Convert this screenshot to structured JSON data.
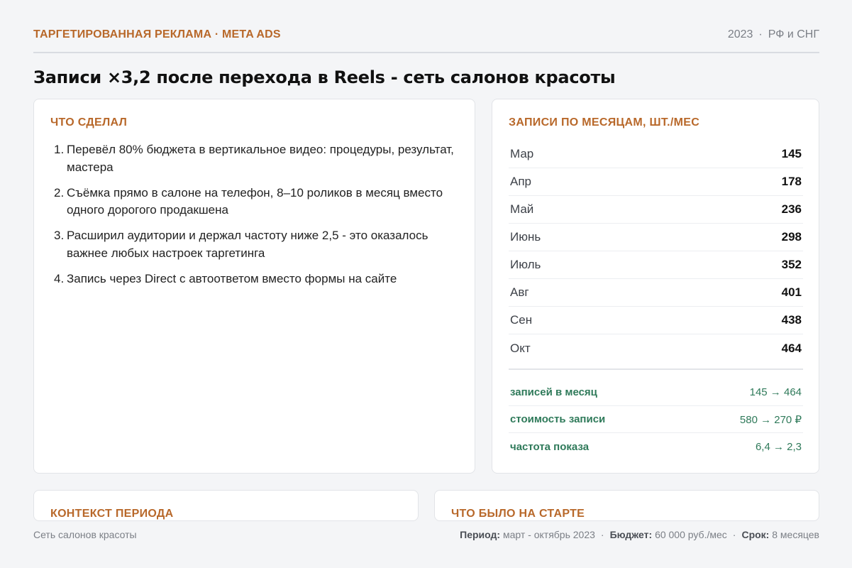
{
  "header": {
    "kicker": "ТАРГЕТИРОВАННАЯ РЕКЛАМА · META ADS",
    "year": "2023",
    "region": "РФ и СНГ"
  },
  "title": "Записи ×3,2 после перехода в Reels - сеть салонов красоты",
  "done": {
    "heading": "ЧТО СДЕЛАЛ",
    "steps": [
      "Перевёл 80% бюджета в вертикальное видео: процедуры, результат, мастера",
      "Съёмка прямо в салоне на телефон, 8–10 роликов в месяц вместо одного дорогого продакшена",
      "Расширил аудитории и держал частоту ниже 2,5 - это оказалось важнее любых настроек таргетинга",
      "Запись через Direct с автоответом вместо формы на сайте"
    ]
  },
  "monthly": {
    "heading": "ЗАПИСИ ПО МЕСЯЦАМ, ШТ./МЕС",
    "rows": [
      {
        "month": "Мар",
        "value": "145"
      },
      {
        "month": "Апр",
        "value": "178"
      },
      {
        "month": "Май",
        "value": "236"
      },
      {
        "month": "Июнь",
        "value": "298"
      },
      {
        "month": "Июль",
        "value": "352"
      },
      {
        "month": "Авг",
        "value": "401"
      },
      {
        "month": "Сен",
        "value": "438"
      },
      {
        "month": "Окт",
        "value": "464"
      }
    ],
    "kpis": [
      {
        "label": "записей в месяц",
        "value": "145 → 464"
      },
      {
        "label": "стоимость записи",
        "value": "580 → 270 ₽"
      },
      {
        "label": "частота показа",
        "value": "6,4 → 2,3"
      }
    ]
  },
  "context": {
    "heading": "КОНТЕКСТ ПЕРИОДА"
  },
  "start": {
    "heading": "ЧТО БЫЛО НА СТАРТЕ"
  },
  "footer": {
    "client": "Сеть салонов красоты",
    "period_label": "Период:",
    "period_value": "март - октябрь 2023",
    "budget_label": "Бюджет:",
    "budget_value": "60 000 руб./мес",
    "term_label": "Срок:",
    "term_value": "8 месяцев"
  },
  "colors": {
    "accent": "#b8682a",
    "kpi": "#2f7a5a",
    "background": "#f4f5f7"
  }
}
